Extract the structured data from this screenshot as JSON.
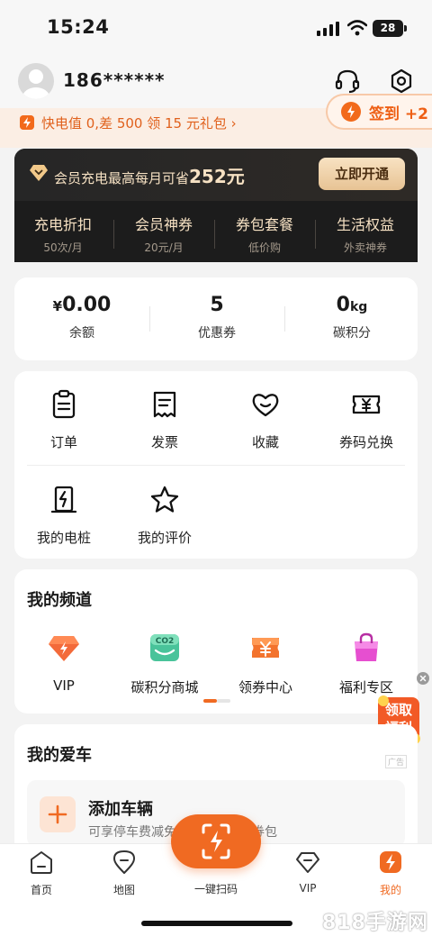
{
  "status_bar": {
    "time": "15:24",
    "battery": "28"
  },
  "header": {
    "phone": "186******"
  },
  "promo": {
    "text": "快电值 0,差 500 领 15 元礼包 ›",
    "signin_label": "签到 +2"
  },
  "vip_card": {
    "title_prefix": "会员充电最高每月可省",
    "title_amount": "252元",
    "button": "立即开通",
    "items": [
      {
        "title": "充电折扣",
        "sub": "50次/月"
      },
      {
        "title": "会员神券",
        "sub": "20元/月"
      },
      {
        "title": "券包套餐",
        "sub": "低价购"
      },
      {
        "title": "生活权益",
        "sub": "外卖神券"
      }
    ]
  },
  "stats": [
    {
      "value_prefix": "¥",
      "value": "0.00",
      "unit": "",
      "label": "余额"
    },
    {
      "value_prefix": "",
      "value": "5",
      "unit": "",
      "label": "优惠券"
    },
    {
      "value_prefix": "",
      "value": "0",
      "unit": "kg",
      "label": "碳积分"
    }
  ],
  "grid": [
    {
      "label": "订单",
      "icon": "clipboard-icon"
    },
    {
      "label": "发票",
      "icon": "receipt-icon"
    },
    {
      "label": "收藏",
      "icon": "heart-icon"
    },
    {
      "label": "券码兑换",
      "icon": "ticket-icon"
    },
    {
      "label": "我的电桩",
      "icon": "charger-icon"
    },
    {
      "label": "我的评价",
      "icon": "star-icon"
    }
  ],
  "channels": {
    "title": "我的频道",
    "items": [
      {
        "label": "VIP",
        "icon": "vip-diamond-icon"
      },
      {
        "label": "碳积分商城",
        "icon": "co2-shop-icon",
        "badge": "CO2"
      },
      {
        "label": "领券中心",
        "icon": "coupon-center-icon"
      },
      {
        "label": "福利专区",
        "icon": "welfare-bag-icon"
      }
    ]
  },
  "float_gift": {
    "line1": "领取",
    "line2": "福利"
  },
  "my_car": {
    "title": "我的爱车",
    "ad_tag": "广告",
    "add_title": "添加车辆",
    "add_sub": "可享停车费减免，首次认证送券包"
  },
  "tabbar": {
    "items": [
      {
        "label": "首页",
        "icon": "home-icon"
      },
      {
        "label": "地图",
        "icon": "map-pin-icon"
      },
      {
        "label": "一键扫码",
        "icon": "scan-icon"
      },
      {
        "label": "VIP",
        "icon": "vip-icon"
      },
      {
        "label": "我的",
        "icon": "profile-bolt-icon",
        "active": true
      }
    ]
  },
  "watermark": "818手游网",
  "colors": {
    "accent": "#f06a22",
    "vip_bg": "#1c1c1c",
    "gold": "#f6e1c3"
  }
}
